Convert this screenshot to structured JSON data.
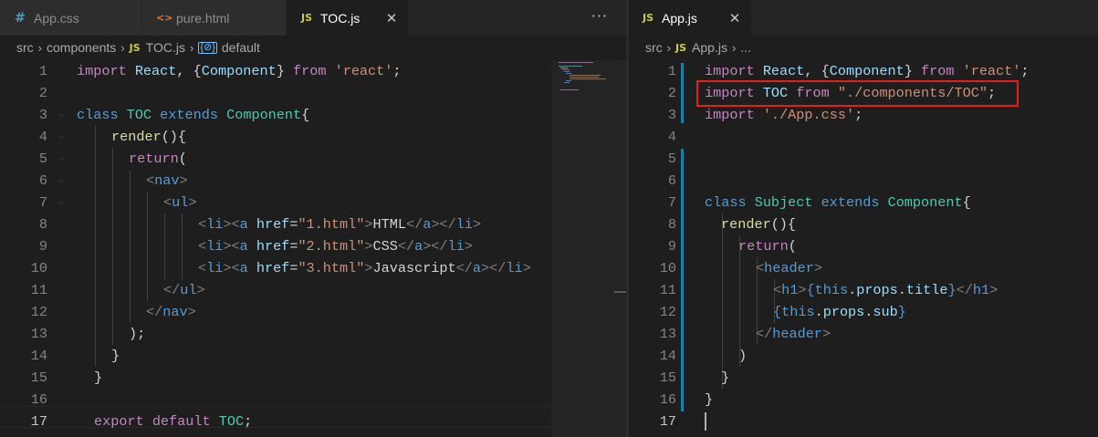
{
  "left_pane": {
    "tabs": [
      {
        "icon": "css-file-icon",
        "glyph": "#",
        "label": "App.css"
      },
      {
        "icon": "html-file-icon",
        "glyph": "<>",
        "label": "pure.html"
      },
      {
        "icon": "js-file-icon",
        "glyph": "JS",
        "label": "TOC.js",
        "close": "✕"
      }
    ],
    "more": "···",
    "breadcrumb": {
      "folder1": "src",
      "folder2": "components",
      "file": "TOC.js",
      "symbol": "default",
      "file_glyph": "JS",
      "symbol_glyph": "{⊘}"
    },
    "line_numbers": [
      "1",
      "2",
      "3",
      "4",
      "5",
      "6",
      "7",
      "8",
      "9",
      "10",
      "11",
      "12",
      "13",
      "14",
      "15",
      "16",
      "17"
    ],
    "current_line": "17"
  },
  "right_pane": {
    "tabs": [
      {
        "icon": "js-file-icon",
        "glyph": "JS",
        "label": "App.js",
        "close": "✕"
      }
    ],
    "breadcrumb": {
      "folder1": "src",
      "file": "App.js",
      "rest": "...",
      "file_glyph": "JS"
    },
    "line_numbers": [
      "1",
      "2",
      "3",
      "4",
      "5",
      "6",
      "7",
      "8",
      "9",
      "10",
      "11",
      "12",
      "13",
      "14",
      "15",
      "16",
      "17"
    ],
    "current_line": "17"
  },
  "colors": {
    "accent_modified": "#1b81a8",
    "highlight_box": "#e51e1e",
    "keyword": "#c586c0",
    "string": "#ce9178",
    "class": "#4ec9b0"
  }
}
